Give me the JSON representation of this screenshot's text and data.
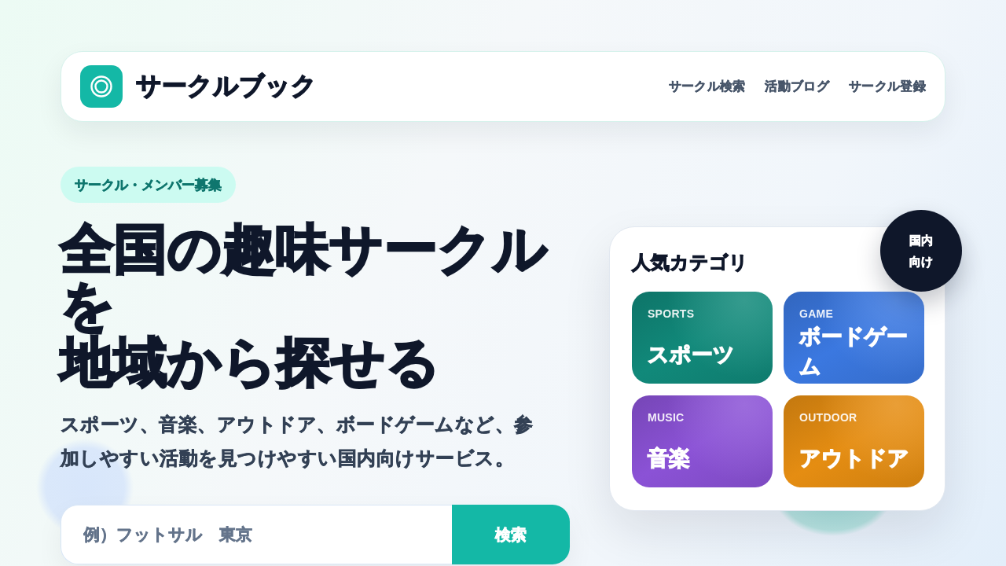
{
  "header": {
    "logo_text": "サークルブック",
    "nav": [
      {
        "label": "サークル検索"
      },
      {
        "label": "活動ブログ"
      },
      {
        "label": "サークル登録"
      }
    ]
  },
  "hero": {
    "badge": "サークル・メンバー募集",
    "heading_lines": [
      "全国の趣味サークルを",
      "地域から探せる"
    ],
    "description": "スポーツ、音楽、アウトドア、ボードゲームなど、参加しやすい活動を見つけやすい国内向けサービス。",
    "search": {
      "placeholder": "例）フットサル　東京",
      "button": "検索"
    }
  },
  "categories_card": {
    "title": "人気カテゴリ",
    "badge": "国内向け",
    "categories": [
      {
        "label": "SPORTS",
        "name": "スポーツ",
        "color": "#11897a"
      },
      {
        "label": "GAME",
        "name": "ボードゲーム",
        "color": "#3b78e0"
      },
      {
        "label": "MUSIC",
        "name": "音楽",
        "color": "#8b52d6"
      },
      {
        "label": "OUTDOOR",
        "name": "アウトドア",
        "color": "#e58d12"
      }
    ]
  }
}
